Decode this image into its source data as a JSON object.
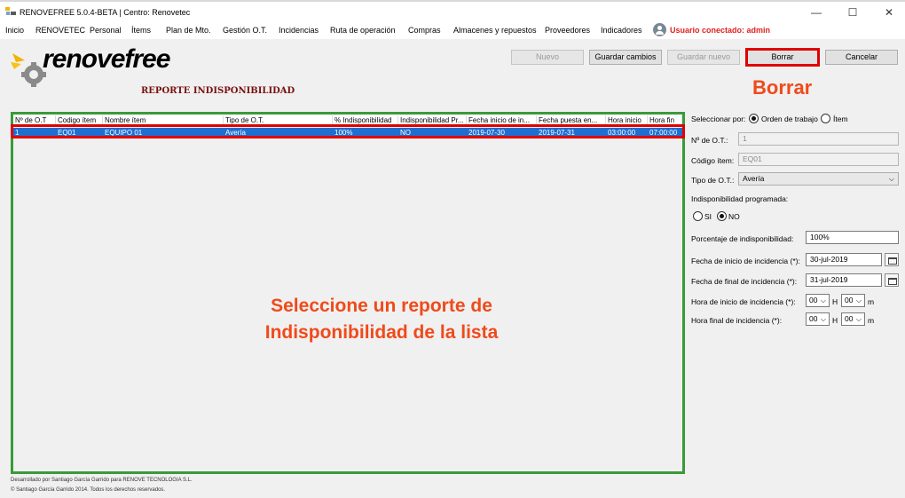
{
  "window": {
    "title": "RENOVEFREE 5.0.4-BETA | Centro: Renovetec",
    "controls": {
      "minimize": "—",
      "maximize": "☐",
      "close": "✕"
    }
  },
  "menu": {
    "items": [
      "Inicio",
      "RENOVETEC",
      "Personal",
      "Ítems",
      "Plan de Mto.",
      "Gestión O.T.",
      "Incidencias",
      "Ruta de operación",
      "Compras",
      "Almacenes y repuestos",
      "Proveedores",
      "Indicadores"
    ],
    "user_label": "Usuario conectado: admin"
  },
  "logo": {
    "text": "renovefree"
  },
  "page_title": "REPORTE INDISPONIBILIDAD",
  "toolbar": {
    "nuevo": "Nuevo",
    "guardar_cambios": "Guardar cambios",
    "guardar_nuevo": "Guardar nuevo",
    "borrar": "Borrar",
    "cancelar": "Cancelar"
  },
  "annotations": {
    "borrar": "Borrar",
    "center_line1": "Seleccione un reporte de",
    "center_line2": "Indisponibilidad de la lista"
  },
  "table": {
    "columns": [
      "Nº de O.T",
      "Codigo ítem",
      "Nombre ítem",
      "Tipo de O.T.",
      "% Indisponibilidad",
      "Indisponibilidad Pr...",
      "Fecha inicio de in...",
      "Fecha puesta en...",
      "Hora inicio",
      "Hora fin"
    ],
    "rows": [
      [
        "1",
        "EQ01",
        "EQUIPO 01",
        "Avería",
        "100%",
        "NO",
        "2019-07-30",
        "2019-07-31",
        "03:00:00",
        "07:00:00"
      ]
    ]
  },
  "form": {
    "seleccionar_por_label": "Seleccionar por:",
    "opt_orden": "Orden de trabajo",
    "opt_item": "Ítem",
    "selected_by": "Orden de trabajo",
    "ot_label": "Nº de O.T.:",
    "ot_value": "1",
    "codigo_label": "Código ítem:",
    "codigo_value": "EQ01",
    "tipo_label": "Tipo de O.T.:",
    "tipo_value": "Avería",
    "programada_label": "Indisponibilidad programada:",
    "opt_si": "SI",
    "opt_no": "NO",
    "programada_value": "NO",
    "porcentaje_label": "Porcentaje de indisponibilidad:",
    "porcentaje_value": "100%",
    "fecha_inicio_label": "Fecha de inicio de incidencia (*):",
    "fecha_inicio_value": "30-jul-2019",
    "fecha_final_label": "Fecha de final de incidencia (*):",
    "fecha_final_value": "31-jul-2019",
    "hora_inicio_label": "Hora de inicio de incidencia (*):",
    "hora_final_label": "Hora final de incidencia (*):",
    "hora_inicio_h": "00",
    "hora_inicio_m": "00",
    "hora_final_h": "00",
    "hora_final_m": "00",
    "h_unit": "H",
    "m_unit": "m"
  },
  "footer": {
    "line1": "Desarrollado por Santiago García Garrido para RENOVE TECNOLOGIA S.L.",
    "line2": "© Santiago García Garrido 2014. Todos los derechos reservados."
  },
  "colors": {
    "selection_blue": "#1e6fd0",
    "highlight_red": "#e00000",
    "annotation_orange": "#f04a1a",
    "grid_border_green": "#3a9a3a",
    "title_maroon": "#7a1010"
  }
}
